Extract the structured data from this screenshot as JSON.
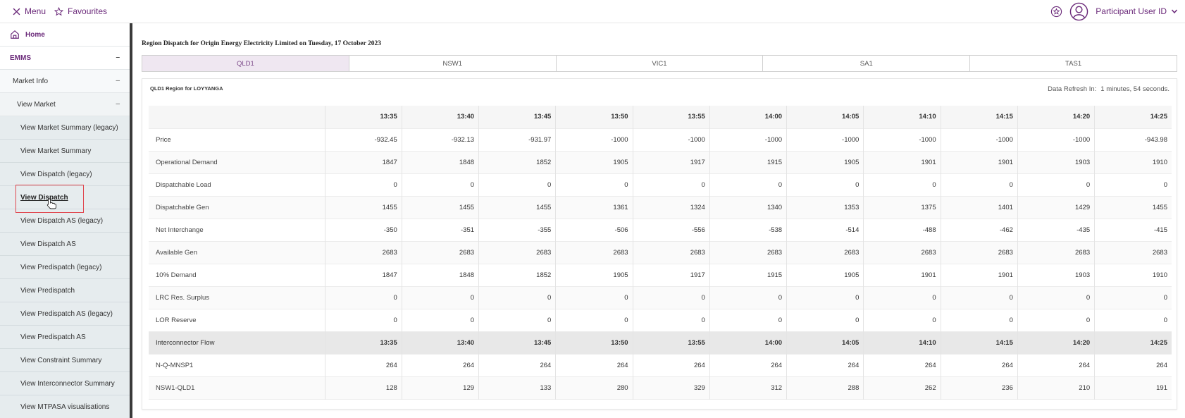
{
  "topbar": {
    "menu_label": "Menu",
    "favourites_label": "Favourites",
    "user_label": "Participant User ID"
  },
  "sidebar": {
    "home": "Home",
    "emms": "EMMS",
    "market_info": "Market Info",
    "view_market": "View Market",
    "dash": "–",
    "items": [
      "View Market Summary (legacy)",
      "View Market Summary",
      "View Dispatch (legacy)",
      "View Dispatch",
      "View Dispatch AS (legacy)",
      "View Dispatch AS",
      "View Predispatch (legacy)",
      "View Predispatch",
      "View Predispatch AS (legacy)",
      "View Predispatch AS",
      "View Constraint Summary",
      "View Interconnector Summary",
      "View MTPASA visualisations"
    ],
    "active_item": "View Dispatch"
  },
  "main": {
    "title": "Region Dispatch for Origin Energy Electricity Limited on Tuesday, 17 October 2023",
    "tabs": [
      "QLD1",
      "NSW1",
      "VIC1",
      "SA1",
      "TAS1"
    ],
    "active_tab": "QLD1",
    "region_title": "QLD1 Region for LOYYANGA",
    "refresh_label": "Data Refresh In:",
    "refresh_value": "1 minutes, 54 seconds."
  },
  "table": {
    "times": [
      "13:35",
      "13:40",
      "13:45",
      "13:50",
      "13:55",
      "14:00",
      "14:05",
      "14:10",
      "14:15",
      "14:20",
      "14:25"
    ],
    "rows": [
      {
        "label": "Price",
        "values": [
          "-932.45",
          "-932.13",
          "-931.97",
          "-1000",
          "-1000",
          "-1000",
          "-1000",
          "-1000",
          "-1000",
          "-1000",
          "-943.98"
        ]
      },
      {
        "label": "Operational Demand",
        "values": [
          "1847",
          "1848",
          "1852",
          "1905",
          "1917",
          "1915",
          "1905",
          "1901",
          "1901",
          "1903",
          "1910"
        ]
      },
      {
        "label": "Dispatchable Load",
        "values": [
          "0",
          "0",
          "0",
          "0",
          "0",
          "0",
          "0",
          "0",
          "0",
          "0",
          "0"
        ]
      },
      {
        "label": "Dispatchable Gen",
        "values": [
          "1455",
          "1455",
          "1455",
          "1361",
          "1324",
          "1340",
          "1353",
          "1375",
          "1401",
          "1429",
          "1455"
        ]
      },
      {
        "label": "Net Interchange",
        "values": [
          "-350",
          "-351",
          "-355",
          "-506",
          "-556",
          "-538",
          "-514",
          "-488",
          "-462",
          "-435",
          "-415"
        ]
      },
      {
        "label": "Available Gen",
        "values": [
          "2683",
          "2683",
          "2683",
          "2683",
          "2683",
          "2683",
          "2683",
          "2683",
          "2683",
          "2683",
          "2683"
        ]
      },
      {
        "label": "10% Demand",
        "values": [
          "1847",
          "1848",
          "1852",
          "1905",
          "1917",
          "1915",
          "1905",
          "1901",
          "1901",
          "1903",
          "1910"
        ]
      },
      {
        "label": "LRC Res. Surplus",
        "values": [
          "0",
          "0",
          "0",
          "0",
          "0",
          "0",
          "0",
          "0",
          "0",
          "0",
          "0"
        ]
      },
      {
        "label": "LOR Reserve",
        "values": [
          "0",
          "0",
          "0",
          "0",
          "0",
          "0",
          "0",
          "0",
          "0",
          "0",
          "0"
        ]
      }
    ],
    "interconnector_label": "Interconnector Flow",
    "interconnector_rows": [
      {
        "label": "N-Q-MNSP1",
        "values": [
          "264",
          "264",
          "264",
          "264",
          "264",
          "264",
          "264",
          "264",
          "264",
          "264",
          "264"
        ]
      },
      {
        "label": "NSW1-QLD1",
        "values": [
          "128",
          "129",
          "133",
          "280",
          "329",
          "312",
          "288",
          "262",
          "236",
          "210",
          "191"
        ]
      }
    ]
  },
  "colors": {
    "brand": "#6b2a7a",
    "active_tab_bg": "#efe7f1",
    "highlight": "#e0464e"
  }
}
